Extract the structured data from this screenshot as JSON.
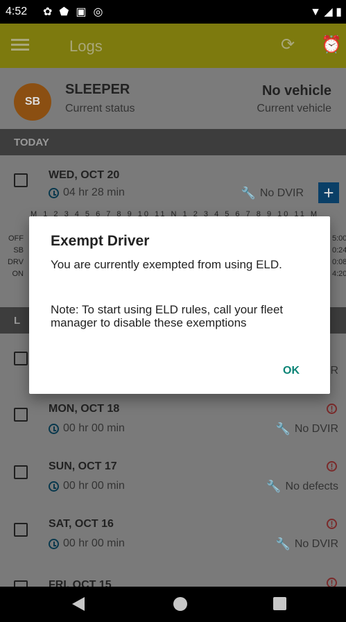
{
  "status_bar": {
    "time": "4:52",
    "icons": [
      "settings-icon",
      "shield-icon",
      "sd-card-icon",
      "at-sign-icon",
      "wifi-icon",
      "signal-icon",
      "battery-icon"
    ]
  },
  "app_bar": {
    "title": "Logs",
    "sync_icon": "sync-icon",
    "alarm_icon": "alarm-icon"
  },
  "profile": {
    "avatar_initials": "SB",
    "status": "SLEEPER",
    "status_label": "Current status",
    "vehicle": "No vehicle",
    "vehicle_label": "Current vehicle"
  },
  "sections": {
    "today": "TODAY",
    "last": "L"
  },
  "today_log": {
    "date": "WED, OCT 20",
    "duration": "04 hr  28 min",
    "dvir": "No DVIR",
    "ticks": "M 1 2 3 4 5 6 7 8 9 10 11 N 1 2 3 4 5 6 7 8 9 10 11 M",
    "status_labels": [
      "OFF",
      "SB",
      "DRV",
      "ON"
    ],
    "right_values": [
      "5:00",
      "0:24",
      "0:08",
      "4:20"
    ]
  },
  "logs": [
    {
      "date": "MON, OCT 18",
      "duration": "00 hr  00 min",
      "dvir": "No DVIR"
    },
    {
      "date": "SUN, OCT 17",
      "duration": "00 hr  00 min",
      "dvir": "No defects"
    },
    {
      "date": "SAT, OCT 16",
      "duration": "00 hr  00 min",
      "dvir": "No DVIR"
    },
    {
      "date": "FRI, OCT 15"
    }
  ],
  "dialog": {
    "title": "Exempt Driver",
    "message": "You are currently exempted from using ELD.",
    "note": "Note: To start using ELD rules, call your fleet manager to disable these exemptions",
    "ok": "OK"
  },
  "colors": {
    "app_bar": "#7d7a0e",
    "background": "#7a7a7a",
    "section": "#3d3d3d",
    "accent": "#0b8476"
  }
}
